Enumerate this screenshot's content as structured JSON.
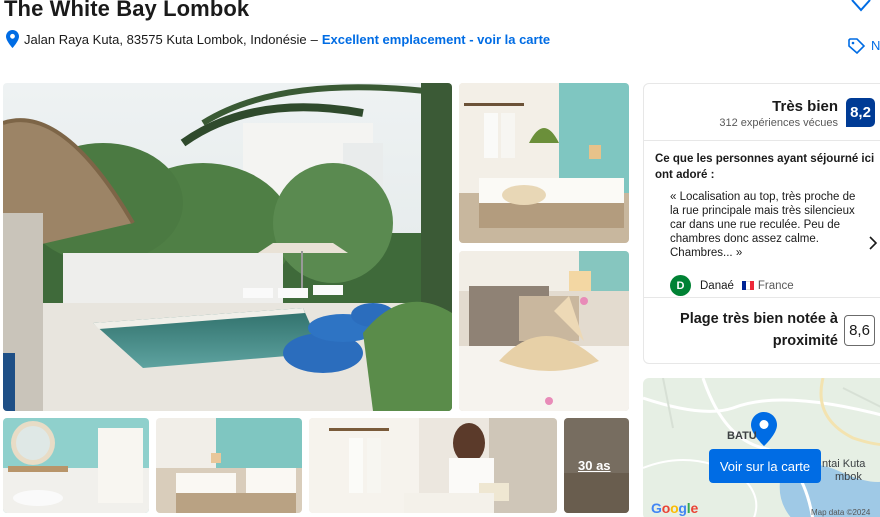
{
  "header": {
    "title": "The White Bay Lombok",
    "address": "Jalan Raya Kuta, 83575 Kuta Lombok, Indonésie",
    "separator": "–",
    "location_link": "Excellent emplacement - voir la carte",
    "tag_text": "N"
  },
  "gallery": {
    "more_photos": "30 as"
  },
  "review_card": {
    "rating_word": "Très bien",
    "review_count": "312 expériences vécues",
    "score": "8,2",
    "liked_title": "Ce que les personnes ayant séjourné ici ont adoré :",
    "quote": "« Localisation au top, très proche de la rue principale mais très silencieux car dans une rue reculée. Peu de chambres donc assez calme. Chambres... »",
    "reviewer_initial": "D",
    "reviewer_name": "Danaé",
    "reviewer_country": "France",
    "beach_label": "Plage très bien notée à proximité",
    "beach_score": "8,6"
  },
  "map": {
    "button_label": "Voir sur la carte",
    "place_label": "BATU",
    "place_label_2": "ntai Kuta",
    "place_label_3": "mbok",
    "copyright": "Map data ©2024"
  },
  "colors": {
    "brand_blue": "#006ce4",
    "score_navy": "#003b95",
    "avatar_green": "#008234"
  },
  "icons": [
    "heart-icon",
    "map-pin-icon",
    "tag-icon",
    "chevron-right-icon",
    "france-flag-icon",
    "map-marker-icon"
  ]
}
